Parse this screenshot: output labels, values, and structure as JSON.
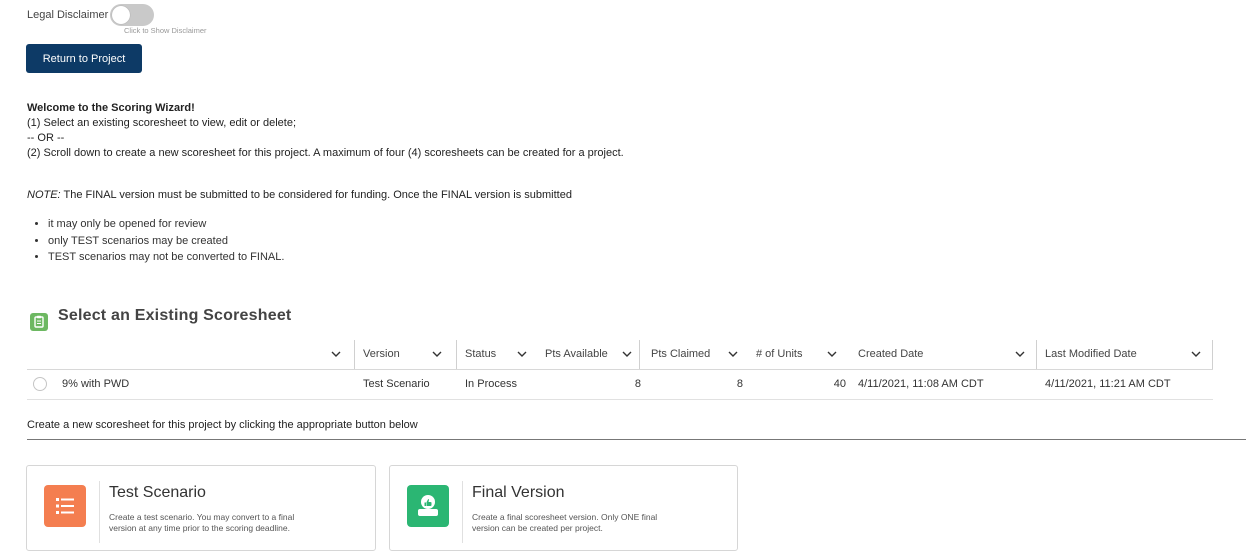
{
  "disclaimer": {
    "label": "Legal Disclaimer",
    "hint": "Click to Show Disclaimer"
  },
  "return_button": "Return to Project",
  "intro": {
    "welcome": "Welcome to the Scoring Wizard!",
    "step1": "(1) Select an existing scoresheet to view, edit or delete;",
    "or": "-- OR --",
    "step2": "(2) Scroll down to create a new scoresheet for this project. A maximum of four (4) scoresheets can be created for a project."
  },
  "note": {
    "prefix": "NOTE:",
    "text": " The FINAL version must be submitted to be considered for funding. Once the FINAL version is submitted",
    "bullets": [
      "it may only be opened for review",
      "only TEST scenarios may be created",
      "TEST scenarios may not be converted to FINAL."
    ]
  },
  "section_title": "Select an Existing Scoresheet",
  "table": {
    "headers": {
      "version": "Version",
      "status": "Status",
      "pts_available": "Pts Available",
      "pts_claimed": "Pts Claimed",
      "units": "# of Units",
      "created": "Created Date",
      "modified": "Last Modified Date"
    },
    "rows": [
      {
        "name": "9% with PWD",
        "version": "Test Scenario",
        "status": "In Process",
        "pts_available": "8",
        "pts_claimed": "8",
        "units": "40",
        "created": "4/11/2021, 11:08 AM CDT",
        "modified": "4/11/2021, 11:21 AM CDT"
      }
    ]
  },
  "create_text": "Create a new scoresheet for this project by clicking the appropriate button below",
  "cards": {
    "test": {
      "title": "Test Scenario",
      "desc_line1": "Create a test scenario. You may convert to a final",
      "desc_line2": "version at any time prior to the scoring deadline.",
      "color": "#f47e50"
    },
    "final": {
      "title": "Final Version",
      "desc_line1": "Create a final scoresheet version. Only ONE final",
      "desc_line2": "version can be created per project.",
      "color": "#2bb673"
    }
  },
  "icons": {
    "section": "clipboard-icon",
    "test_card": "list-icon",
    "final_card": "thumbs-up-icon",
    "chevron": "chevron-down-icon"
  }
}
